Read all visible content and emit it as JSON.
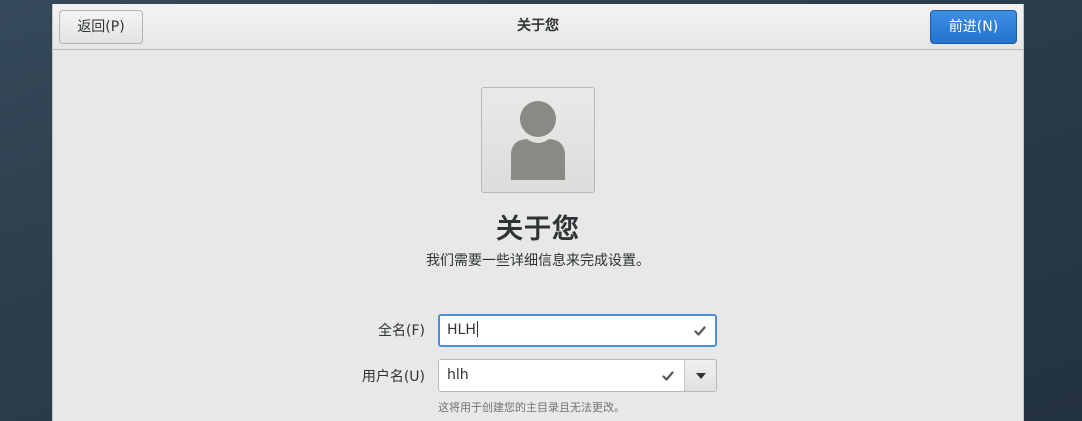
{
  "header": {
    "back_label": "返回(P)",
    "title": "关于您",
    "next_label": "前进(N)"
  },
  "main": {
    "heading": "关于您",
    "subheading": "我们需要一些详细信息来完成设置。"
  },
  "form": {
    "fullname": {
      "label": "全名(F)",
      "value": "HLH",
      "valid": true
    },
    "username": {
      "label": "用户名(U)",
      "value": "hlh",
      "valid": true,
      "hint": "这将用于创建您的主目录且无法更改。"
    }
  },
  "icons": {
    "avatar": "user-silhouette-icon",
    "valid": "checkmark-icon",
    "dropdown": "chevron-down-icon"
  },
  "colors": {
    "accent": "#4a90d9",
    "next_button": "#2a7ad6",
    "avatar_fill": "#888a85"
  }
}
